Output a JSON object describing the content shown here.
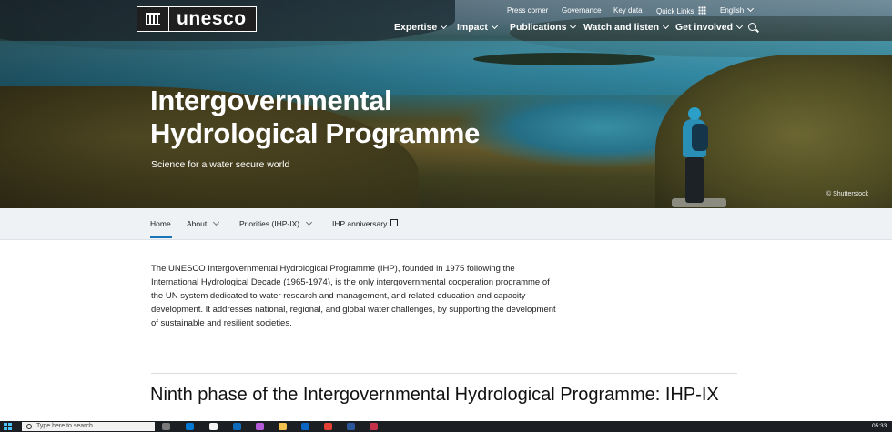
{
  "header": {
    "logo_text": "unesco",
    "utility_links": [
      "Press corner",
      "Governance",
      "Key data",
      "Quick Links",
      "English"
    ],
    "main_nav": [
      "Expertise",
      "Impact",
      "Publications",
      "Watch and listen",
      "Get involved"
    ]
  },
  "hero": {
    "title": "Intergovernmental Hydrological Programme",
    "subtitle": "Science for a water secure world",
    "credit": "© Shutterstock"
  },
  "subnav": {
    "items": [
      "Home",
      "About",
      "Priorities (IHP-IX)",
      "IHP anniversary"
    ]
  },
  "content": {
    "intro": "The UNESCO Intergovernmental Hydrological Programme (IHP), founded in 1975 following the International Hydrological Decade (1965-1974), is the only intergovernmental cooperation programme of the UN system dedicated to water research and management, and related education and capacity development. It addresses national, regional, and global water challenges, by supporting the development of sustainable and resilient societies.",
    "section_heading": "Ninth phase of the Intergovernmental Hydrological Programme: IHP-IX"
  },
  "taskbar": {
    "search_placeholder": "Type here to search",
    "time": "05:33"
  },
  "colors": {
    "accent": "#1a73b7",
    "subnav_bg": "#eef2f5",
    "taskbar_bg": "#1b1f24"
  }
}
